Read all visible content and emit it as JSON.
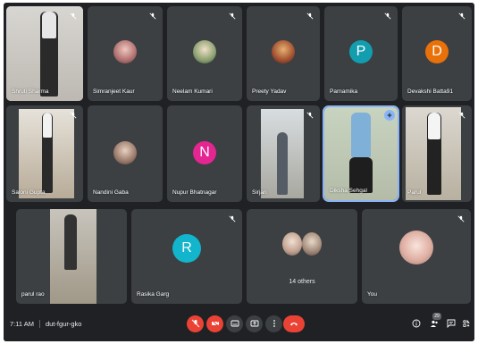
{
  "participants": {
    "p1": "Shruti Sharma",
    "p2": "Simranjeet Kaur",
    "p3": "Neelam Kumari",
    "p4": "Preety Yadav",
    "p5": "Parnamika",
    "p6": "Devakshi Batta91",
    "p7": "Saloni Gupta",
    "p8": "Nandini Gaba",
    "p9": "Nupur Bhatnagar",
    "p10": "Sirjan",
    "p11": "Diksha Sehgal",
    "p12": "Parul",
    "p13": "parul rao",
    "p14": "Rasika Garg",
    "p15": "14 others",
    "p16": "You"
  },
  "avatar_letters": {
    "parnamika": "P",
    "devakshi": "D",
    "nupur": "N",
    "rasika": "R"
  },
  "colors": {
    "parnamika": "#129eaf",
    "devakshi": "#e8710a",
    "nupur": "#e52592",
    "rasika": "#12b5cb",
    "end_call": "#ea4335",
    "active_border": "#8ab4f8"
  },
  "bottom_bar": {
    "time": "7:11 AM",
    "meeting_code": "dut-fgur-gko",
    "people_count": "29"
  },
  "icons": [
    "mic-off-icon",
    "camera-off-icon",
    "captions-icon",
    "present-icon",
    "more-options-icon",
    "end-call-icon",
    "info-icon",
    "people-icon",
    "chat-icon",
    "activities-icon"
  ]
}
